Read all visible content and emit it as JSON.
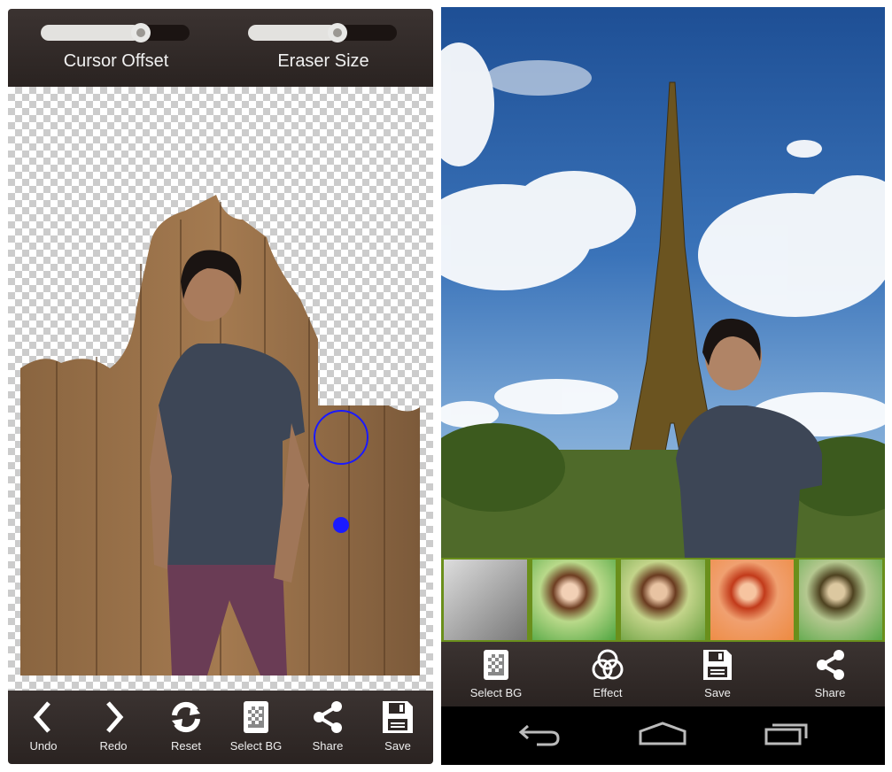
{
  "left_app": {
    "sliders": [
      {
        "label": "Cursor Offset",
        "value": 0.67
      },
      {
        "label": "Eraser Size",
        "value": 0.6
      }
    ],
    "toolbar": [
      {
        "label": "Undo",
        "icon": "chevron-left-icon"
      },
      {
        "label": "Redo",
        "icon": "chevron-right-icon"
      },
      {
        "label": "Reset",
        "icon": "refresh-icon"
      },
      {
        "label": "Select BG",
        "icon": "checkerboard-icon"
      },
      {
        "label": "Share",
        "icon": "share-icon"
      },
      {
        "label": "Save",
        "icon": "floppy-disk-icon"
      }
    ],
    "colors": {
      "bar": "#2f2826",
      "eraser_cursor": "#1a1aff"
    }
  },
  "right_app": {
    "filters": [
      "grayscale",
      "original",
      "warm",
      "orange",
      "sepia-green"
    ],
    "toolbar": [
      {
        "label": "Select BG",
        "icon": "checkerboard-icon"
      },
      {
        "label": "Effect",
        "icon": "circles-icon"
      },
      {
        "label": "Save",
        "icon": "floppy-disk-icon"
      },
      {
        "label": "Share",
        "icon": "share-icon"
      }
    ],
    "navbar": [
      "back-icon",
      "home-icon",
      "recent-apps-icon"
    ]
  }
}
